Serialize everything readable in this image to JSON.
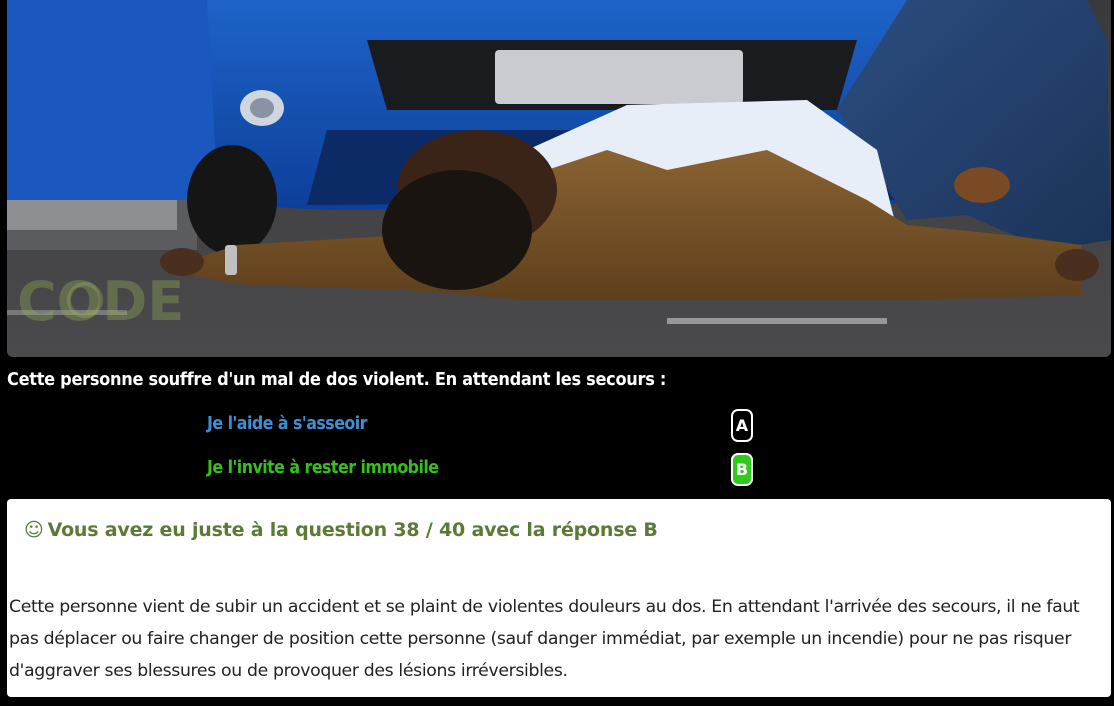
{
  "photo": {
    "alt": "Homme allongé sur la route devant une voiture bleue",
    "watermark": "CODE"
  },
  "question": {
    "text": "Cette personne souffre d'un mal de dos violent. En attendant les secours :"
  },
  "answers": [
    {
      "key": "A",
      "text": "Je l'aide à s'asseoir",
      "selected": false,
      "color": "#3f8fd6"
    },
    {
      "key": "B",
      "text": "Je l'invite à rester immobile",
      "selected": true,
      "color": "#33c11a"
    }
  ],
  "result": {
    "icon": "smile-icon",
    "smile_glyph": "☺",
    "title": "Vous avez eu juste à la question 38 / 40 avec la réponse B",
    "explanation": "Cette personne vient de subir un accident et se plaint de violentes douleurs au dos. En attendant l'arrivée des secours, il ne faut pas déplacer ou faire changer de position cette personne (sauf danger immédiat, par exemple un incendie) pour ne pas risquer d'aggraver ses blessures ou de provoquer des lésions irréversibles.",
    "title_color": "#5a7a36"
  },
  "colors": {
    "background": "#000000",
    "answer_a": "#3f8fd6",
    "answer_b": "#33c11a",
    "selected_key_bg": "#2ecc1a"
  }
}
